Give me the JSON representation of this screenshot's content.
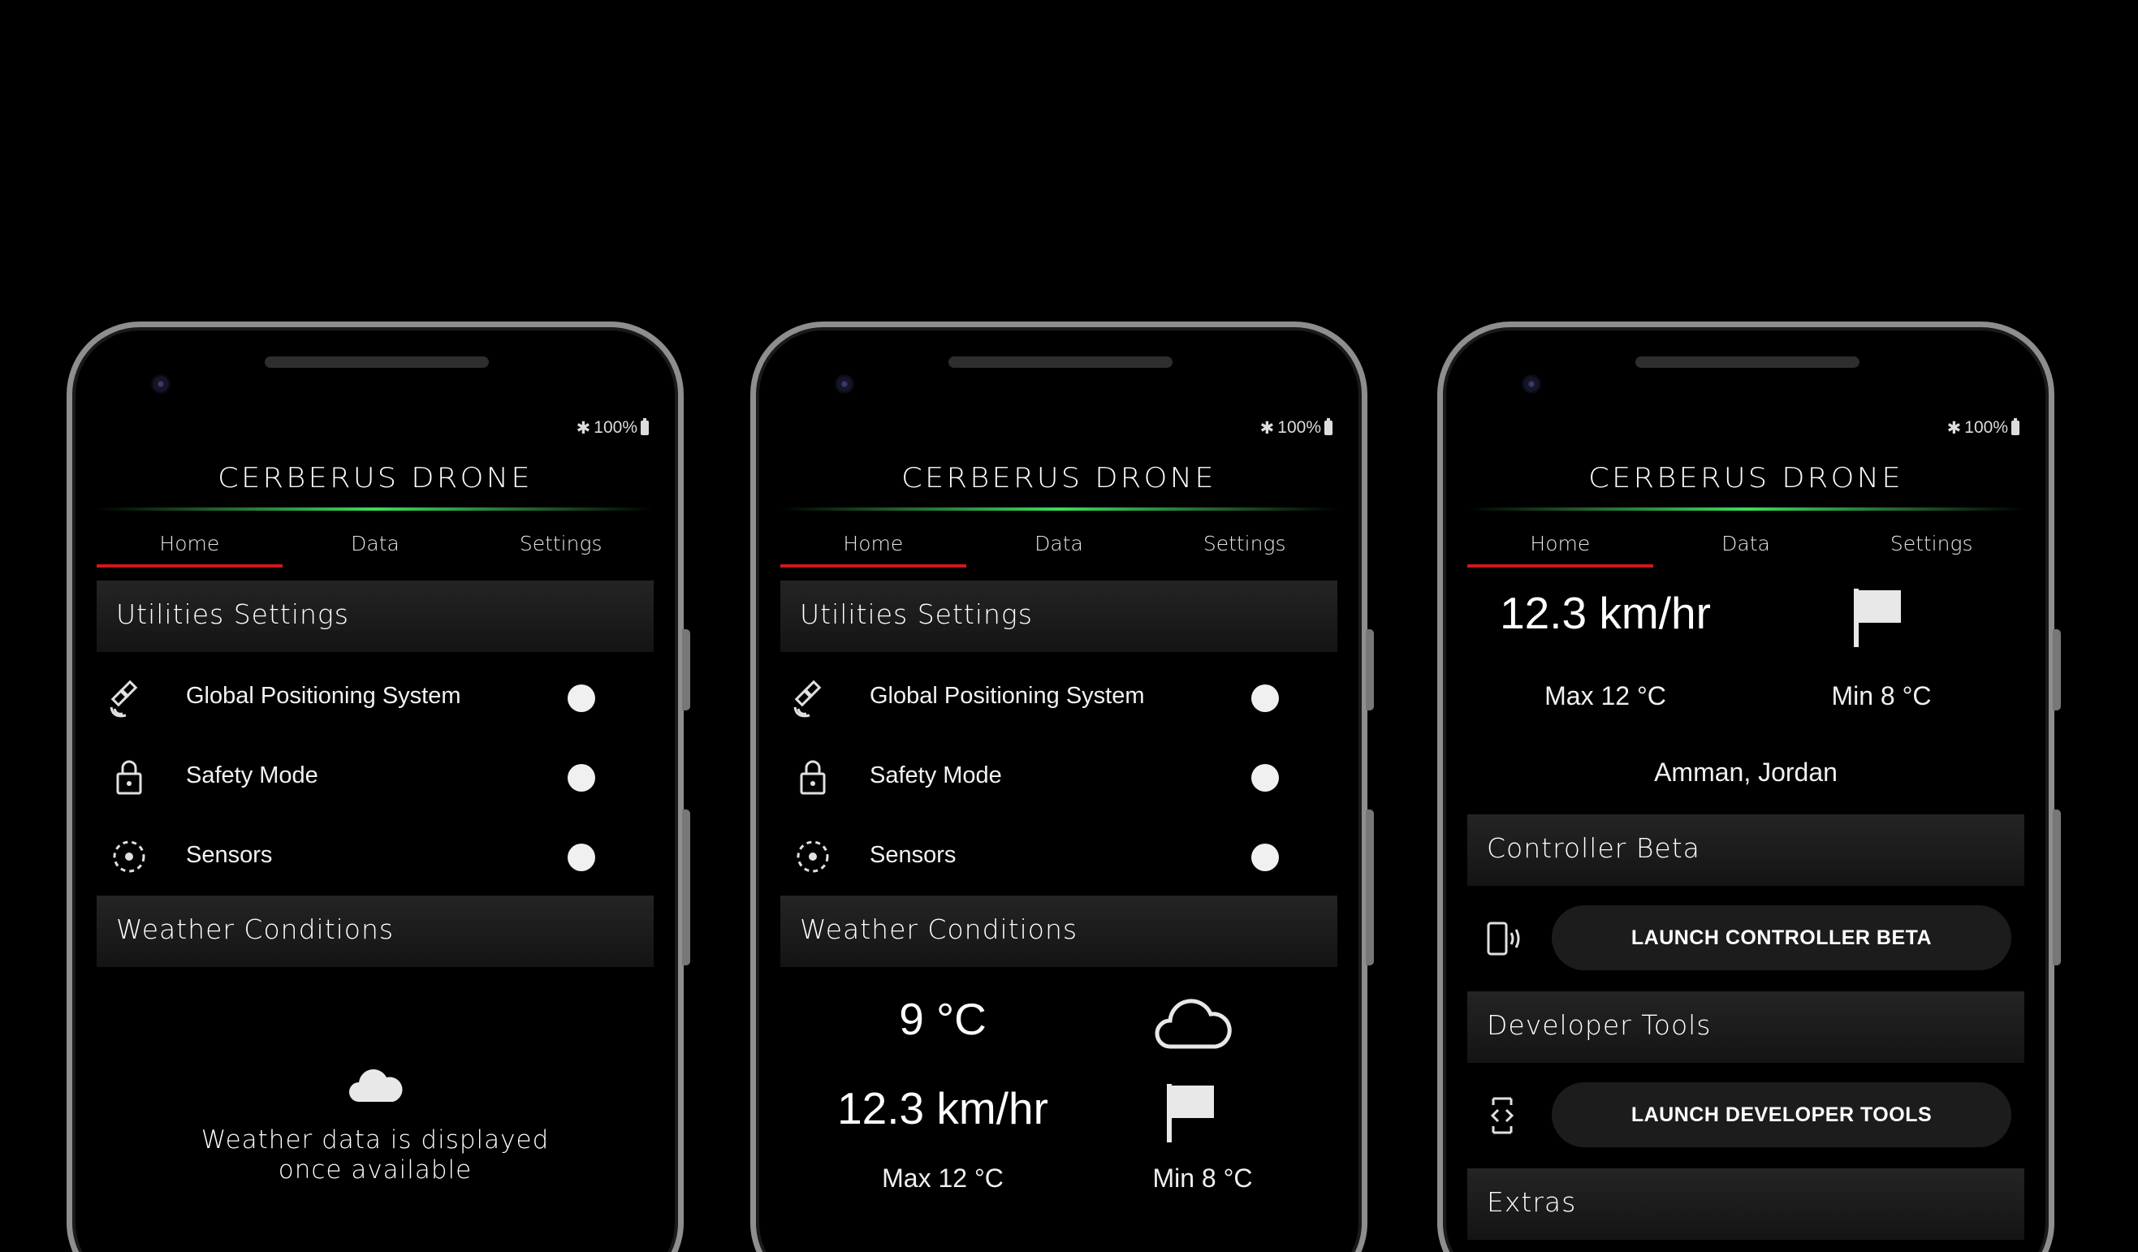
{
  "app": {
    "title": "CERBERUS DRONE",
    "battery": "100%",
    "tabs": [
      "Home",
      "Data",
      "Settings"
    ],
    "accent_color": "#d0181c",
    "title_glow_color": "#3cdc5a"
  },
  "sections": {
    "utilities": "Utilities Settings",
    "weather": "Weather Conditions",
    "controller": "Controller Beta",
    "developer": "Developer Tools",
    "extras": "Extras"
  },
  "utilities": [
    {
      "label": "Global Positioning System",
      "icon": "satellite-icon"
    },
    {
      "label": "Safety Mode",
      "icon": "lock-icon"
    },
    {
      "label": "Sensors",
      "icon": "sensor-icon"
    }
  ],
  "weather_empty": {
    "line1": "Weather data is displayed",
    "line2": "once available"
  },
  "weather": {
    "temperature": "9 °C",
    "wind": "12.3 km/hr",
    "max": "Max 12 °C",
    "min": "Min 8 °C",
    "location": "Amman, Jordan"
  },
  "buttons": {
    "controller": "LAUNCH CONTROLLER BETA",
    "developer": "LAUNCH DEVELOPER TOOLS"
  }
}
